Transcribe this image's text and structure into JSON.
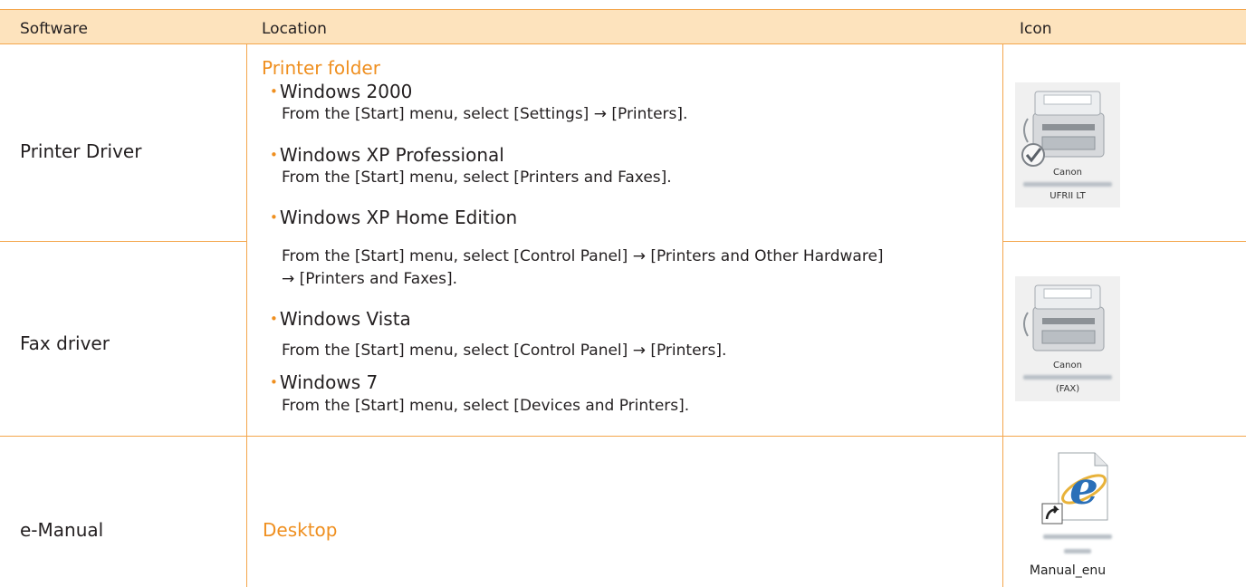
{
  "header": {
    "software": "Software",
    "location": "Location",
    "icon": "Icon"
  },
  "rows": [
    {
      "software": "Printer Driver",
      "icon_caption_top": "Canon",
      "icon_caption_bottom": "UFRII LT",
      "icon_name": "printer-icon"
    },
    {
      "software": "Fax driver",
      "icon_caption_top": "Canon",
      "icon_caption_bottom": "(FAX)",
      "icon_name": "fax-printer-icon"
    },
    {
      "software": "e-Manual",
      "location": "Desktop",
      "icon_caption": "Manual_enu",
      "icon_name": "internet-explorer-shortcut-icon"
    }
  ],
  "printer_folder": {
    "title": "Printer folder",
    "bullet": "•",
    "items": [
      {
        "os": "Windows 2000",
        "steps": [
          "From the [Start] menu, select [Settings] → [Printers]."
        ]
      },
      {
        "os": "Windows XP Professional",
        "steps": [
          "From the [Start] menu, select [Printers and Faxes]."
        ]
      },
      {
        "os": "Windows XP Home Edition",
        "steps": [
          "From the [Start] menu, select [Control Panel] → [Printers and Other Hardware]",
          "→ [Printers and Faxes]."
        ]
      },
      {
        "os": "Windows Vista",
        "steps": [
          "From the [Start] menu, select [Control Panel] → [Printers]."
        ]
      },
      {
        "os": "Windows 7",
        "steps": [
          "From the [Start] menu, select [Devices and Printers]."
        ]
      }
    ]
  },
  "colors": {
    "accent": "#ef8f1f",
    "header_bg": "#fde3bd",
    "rule": "#f4a64c"
  }
}
